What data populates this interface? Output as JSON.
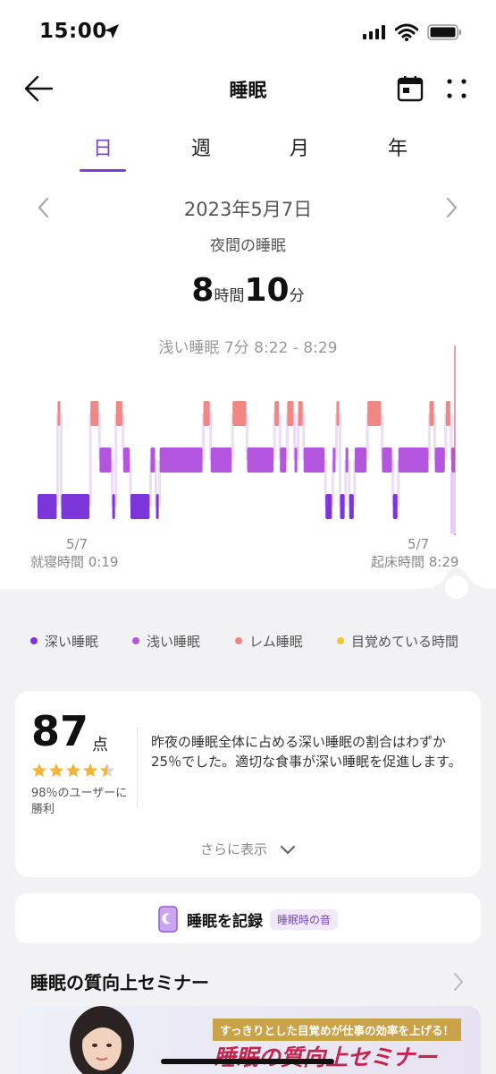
{
  "status": {
    "time": "15:00"
  },
  "header": {
    "title": "睡眠"
  },
  "tabs": [
    {
      "label": "日",
      "active": true
    },
    {
      "label": "週",
      "active": false
    },
    {
      "label": "月",
      "active": false
    },
    {
      "label": "年",
      "active": false
    }
  ],
  "date": "2023年5月7日",
  "subtitle": "夜間の睡眠",
  "duration": {
    "hours": "8",
    "hours_unit": "時間",
    "minutes": "10",
    "minutes_unit": "分"
  },
  "selected_stage": "浅い睡眠 7分 8:22 - 8:29",
  "chart_data": {
    "type": "hypnogram",
    "start": {
      "date": "5/7",
      "label": "就寝時間 0:19"
    },
    "end": {
      "date": "5/7",
      "label": "起床時間 8:29"
    },
    "stages": [
      "レム睡眠",
      "浅い睡眠",
      "深い睡眠"
    ],
    "timeline": [
      {
        "stage": "深い睡眠",
        "d": 22
      },
      {
        "stage": "レム睡眠",
        "d": 4
      },
      {
        "stage": "深い睡眠",
        "d": 32
      },
      {
        "stage": "レム睡眠",
        "d": 10
      },
      {
        "stage": "浅い睡眠",
        "d": 14
      },
      {
        "stage": "深い睡眠",
        "d": 4
      },
      {
        "stage": "レム睡眠",
        "d": 8
      },
      {
        "stage": "浅い睡眠",
        "d": 8
      },
      {
        "stage": "深い睡眠",
        "d": 22
      },
      {
        "stage": "浅い睡眠",
        "d": 6
      },
      {
        "stage": "深い睡眠",
        "d": 4
      },
      {
        "stage": "浅い睡眠",
        "d": 48
      },
      {
        "stage": "レム睡眠",
        "d": 8
      },
      {
        "stage": "浅い睡眠",
        "d": 24
      },
      {
        "stage": "レム睡眠",
        "d": 16
      },
      {
        "stage": "浅い睡眠",
        "d": 30
      },
      {
        "stage": "レム睡眠",
        "d": 6
      },
      {
        "stage": "浅い睡眠",
        "d": 8
      },
      {
        "stage": "レム睡眠",
        "d": 8
      },
      {
        "stage": "浅い睡眠",
        "d": 4
      },
      {
        "stage": "レム睡眠",
        "d": 6
      },
      {
        "stage": "浅い睡眠",
        "d": 24
      },
      {
        "stage": "深い睡眠",
        "d": 8
      },
      {
        "stage": "浅い睡眠",
        "d": 4
      },
      {
        "stage": "レム睡眠",
        "d": 4
      },
      {
        "stage": "深い睡眠",
        "d": 6
      },
      {
        "stage": "浅い睡眠",
        "d": 4
      },
      {
        "stage": "深い睡眠",
        "d": 6
      },
      {
        "stage": "浅い睡眠",
        "d": 14
      },
      {
        "stage": "レム睡眠",
        "d": 16
      },
      {
        "stage": "浅い睡眠",
        "d": 12
      },
      {
        "stage": "深い睡眠",
        "d": 6
      },
      {
        "stage": "浅い睡眠",
        "d": 34
      },
      {
        "stage": "レム睡眠",
        "d": 6
      },
      {
        "stage": "浅い睡眠",
        "d": 12
      },
      {
        "stage": "レム睡眠",
        "d": 6
      },
      {
        "stage": "浅い睡眠",
        "d": 5
      }
    ]
  },
  "legend": [
    {
      "label": "深い睡眠",
      "color": "#7b35d9"
    },
    {
      "label": "浅い睡眠",
      "color": "#b455e0"
    },
    {
      "label": "レム睡眠",
      "color": "#f08785"
    },
    {
      "label": "目覚めている時間",
      "color": "#f2c53a"
    }
  ],
  "score_card": {
    "score": "87",
    "unit": "点",
    "rating": 4.5,
    "beat_text": "98％のユーザーに勝利",
    "text": "昨夜の睡眠全体に占める深い睡眠の割合はわずか25％でした。適切な食事が深い睡眠を促進します。",
    "more": "さらに表示"
  },
  "record": {
    "label": "睡眠を記録",
    "tag": "睡眠時の音"
  },
  "seminar": {
    "title": "睡眠の質向上セミナー",
    "banner_tag": "すっきりとした目覚めが仕事の効率を上げる！",
    "banner_title": "睡眠の質向上セミナー"
  }
}
